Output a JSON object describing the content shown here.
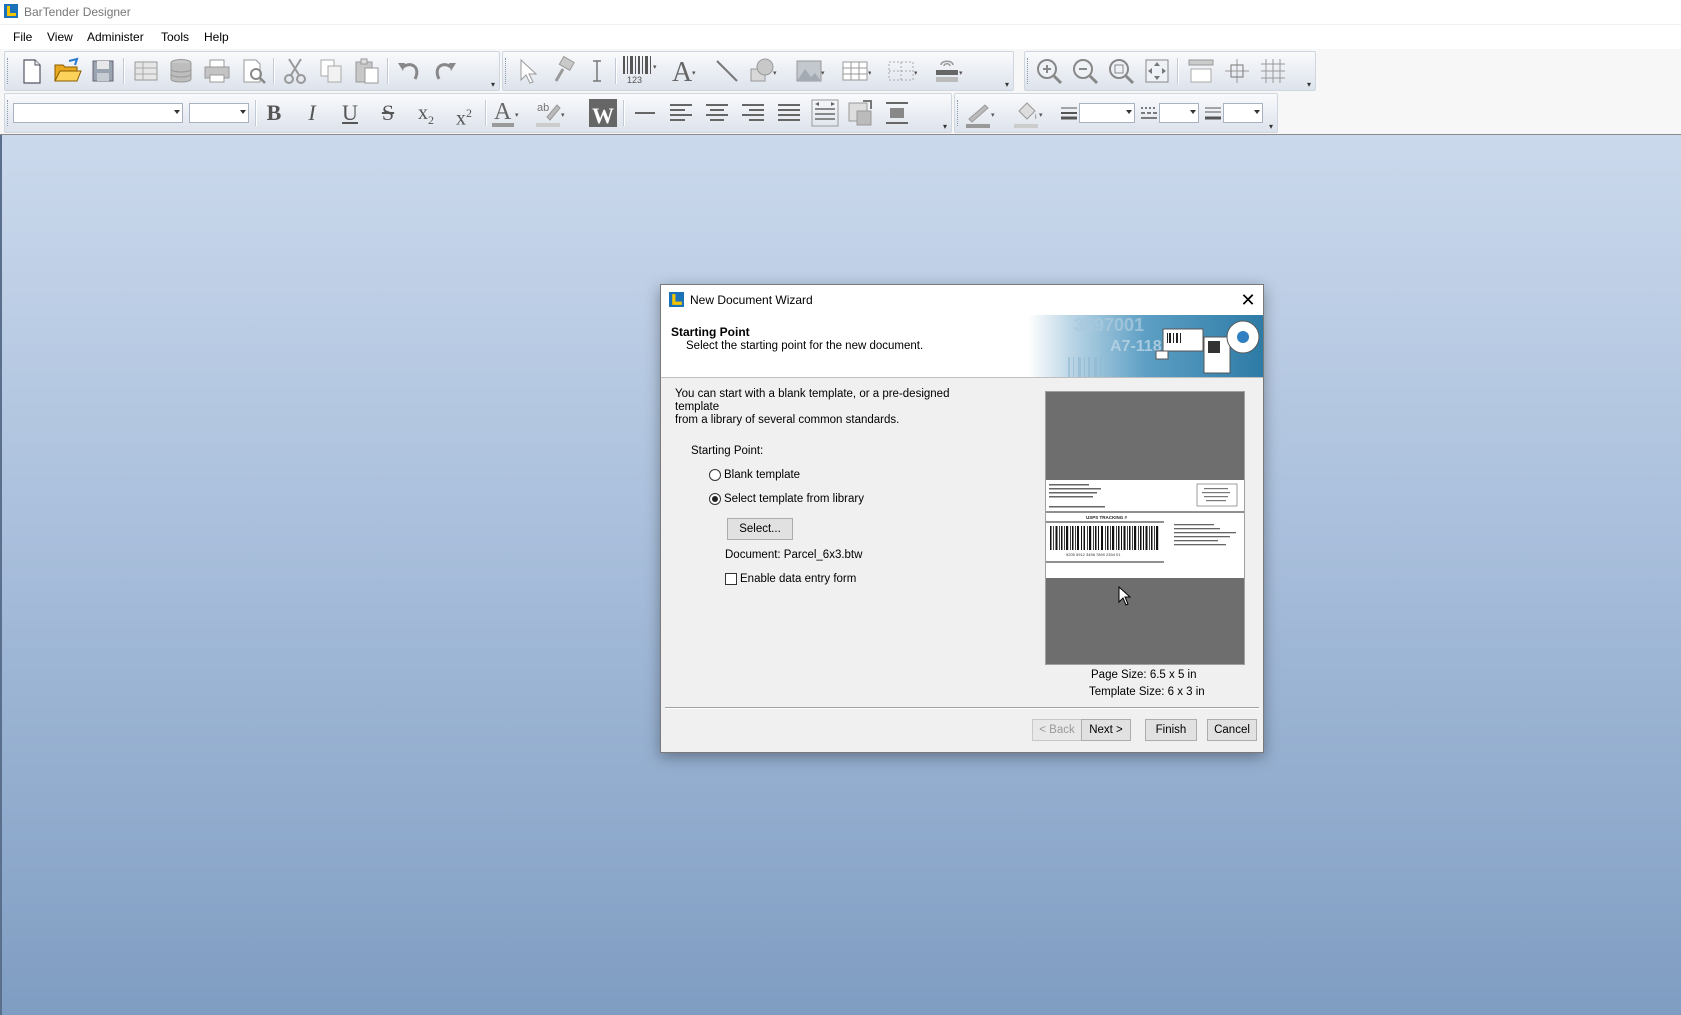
{
  "app": {
    "title": "BarTender Designer"
  },
  "menu": {
    "items": [
      "File",
      "View",
      "Administer",
      "Tools",
      "Help"
    ]
  },
  "toolbar": {
    "barcode_caption": "123"
  },
  "dialog": {
    "title": "New Document Wizard",
    "header_title": "Starting Point",
    "header_subtitle": "Select the starting point for the new document.",
    "banner_text_1": "3597001",
    "banner_text_2": "A7-118",
    "intro_line1": "You can start with a blank template, or a pre-designed template",
    "intro_line2": "from a library of several common standards.",
    "starting_point_label": "Starting Point:",
    "radio_blank": "Blank template",
    "radio_library": "Select template from library",
    "selected_option": "radio_library",
    "select_button": "Select...",
    "document_label": "Document: Parcel_6x3.btw",
    "enable_form_label": "Enable data entry form",
    "enable_form_checked": false,
    "page_size": "Page Size:  6.5 x 5 in",
    "template_size": "Template Size:  6 x 3 in",
    "buttons": {
      "back": "< Back",
      "next": "Next  >",
      "finish": "Finish",
      "cancel": "Cancel"
    },
    "preview_label": {
      "tracking_title": "USPS TRACKING #",
      "tracking_number": "9205 5912 3456 7890 2394 01"
    }
  }
}
